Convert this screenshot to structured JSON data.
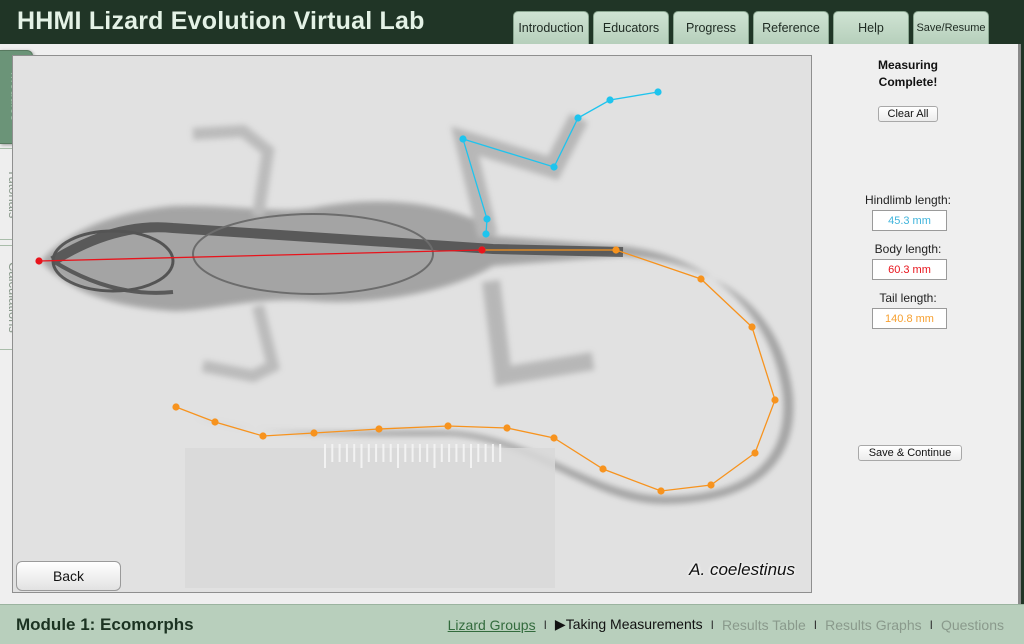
{
  "app": {
    "title": "HHMI Lizard Evolution Virtual Lab"
  },
  "nav": {
    "tabs": [
      {
        "label": "Introduction"
      },
      {
        "label": "Educators"
      },
      {
        "label": "Progress"
      },
      {
        "label": "Reference"
      },
      {
        "label": "Help"
      },
      {
        "label": "Save/Resume"
      }
    ]
  },
  "sidebar": {
    "tabs": [
      {
        "label": "Modules",
        "active": true
      },
      {
        "label": "Tutorials",
        "active": false
      },
      {
        "label": "Calculations",
        "active": false
      }
    ]
  },
  "xray": {
    "species": "A. coelestinus",
    "back_label": "Back",
    "measurements": {
      "body": {
        "color": "#e8141c",
        "points": [
          [
            26,
            205
          ],
          [
            469,
            194
          ]
        ]
      },
      "hindlimb": {
        "color": "#1ec4ee",
        "points": [
          [
            473,
            178
          ],
          [
            474,
            163
          ],
          [
            450,
            83
          ],
          [
            541,
            111
          ],
          [
            565,
            62
          ],
          [
            597,
            44
          ],
          [
            645,
            36
          ]
        ]
      },
      "tail": {
        "color": "#f7931e",
        "points": [
          [
            469,
            194
          ],
          [
            603,
            194
          ],
          [
            688,
            223
          ],
          [
            739,
            271
          ],
          [
            762,
            344
          ],
          [
            742,
            397
          ],
          [
            698,
            429
          ],
          [
            648,
            435
          ],
          [
            590,
            413
          ],
          [
            541,
            382
          ],
          [
            494,
            372
          ],
          [
            435,
            370
          ],
          [
            366,
            373
          ],
          [
            301,
            377
          ],
          [
            250,
            380
          ],
          [
            202,
            366
          ],
          [
            163,
            351
          ]
        ]
      }
    }
  },
  "panel": {
    "status_line1": "Measuring",
    "status_line2": "Complete!",
    "clear_label": "Clear All",
    "hindlimb_label": "Hindlimb length:",
    "hindlimb_value": "45.3 mm",
    "hindlimb_color": "#3fb4dc",
    "body_label": "Body length:",
    "body_value": "60.3 mm",
    "body_color": "#e8141c",
    "tail_label": "Tail length:",
    "tail_value": "140.8 mm",
    "tail_color": "#f7a030",
    "save_label": "Save & Continue"
  },
  "footer": {
    "module_title": "Module 1: Ecomorphs",
    "crumbs": [
      {
        "label": "Lizard Groups",
        "state": "link"
      },
      {
        "label": "▶Taking Measurements",
        "state": "current"
      },
      {
        "label": "Results Table",
        "state": "disabled"
      },
      {
        "label": "Results Graphs",
        "state": "disabled"
      },
      {
        "label": "Questions",
        "state": "disabled"
      }
    ],
    "separator": "I"
  }
}
